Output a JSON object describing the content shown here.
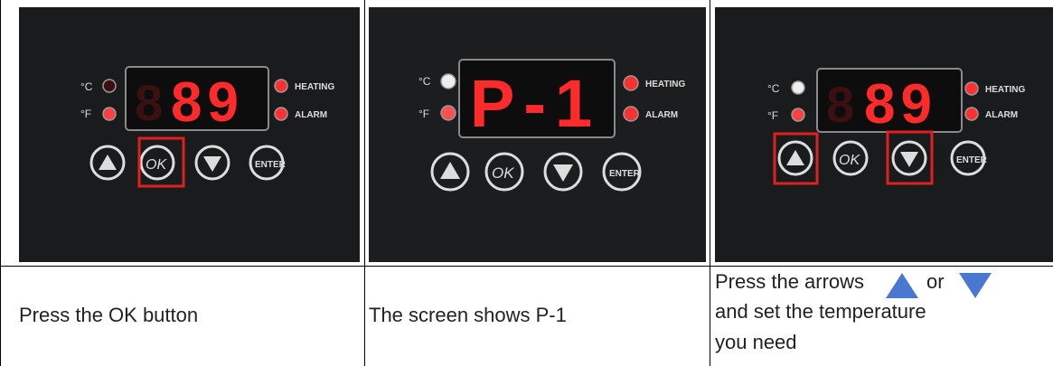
{
  "steps": [
    {
      "display": "89",
      "leading_digit_dim": "8",
      "indicators": {
        "unit_c": "°C",
        "unit_f": "°F",
        "heating": "HEATING",
        "alarm": "ALARM"
      },
      "buttons": {
        "up": "▲",
        "ok": "OK",
        "down": "▼",
        "enter": "ENTER"
      },
      "highlight": [
        "ok"
      ],
      "caption": "Press the OK button"
    },
    {
      "display": "P-1",
      "leading_digit_dim": "",
      "indicators": {
        "unit_c": "°C",
        "unit_f": "°F",
        "heating": "HEATING",
        "alarm": "ALARM"
      },
      "buttons": {
        "up": "▲",
        "ok": "OK",
        "down": "▼",
        "enter": "ENTER"
      },
      "highlight": [],
      "caption": "The screen shows P-1"
    },
    {
      "display": "89",
      "leading_digit_dim": "8",
      "indicators": {
        "unit_c": "°C",
        "unit_f": "°F",
        "heating": "HEATING",
        "alarm": "ALARM"
      },
      "buttons": {
        "up": "▲",
        "ok": "OK",
        "down": "▼",
        "enter": "ENTER"
      },
      "highlight": [
        "up",
        "down"
      ],
      "caption_parts": [
        "Press the arrows",
        "or",
        "and set the temperature",
        "you need"
      ],
      "caption_icons": [
        "up-triangle-icon",
        "down-triangle-icon"
      ]
    }
  ],
  "colors": {
    "led_red": "#ff2a2a",
    "led_dim": "#3a1010",
    "highlight_box": "#e02020",
    "arrow_blue": "#4a78d0",
    "panel_dark": "#161718"
  }
}
